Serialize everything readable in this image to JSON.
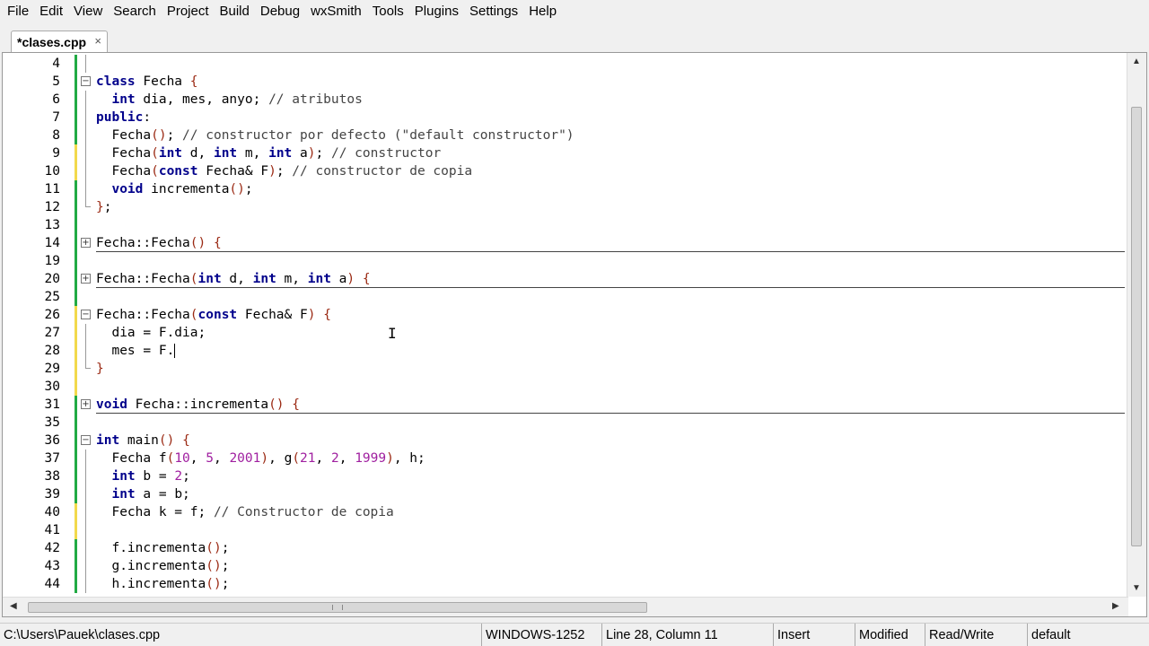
{
  "menu": [
    "File",
    "Edit",
    "View",
    "Search",
    "Project",
    "Build",
    "Debug",
    "wxSmith",
    "Tools",
    "Plugins",
    "Settings",
    "Help"
  ],
  "tab": {
    "label": "*clases.cpp",
    "close": "×"
  },
  "code": [
    {
      "n": "4",
      "fold": "line",
      "mark": "green",
      "html": ""
    },
    {
      "n": "5",
      "fold": "minus",
      "mark": "green",
      "html": "<span class='kw'>class</span> Fecha <span class='br'>{</span>"
    },
    {
      "n": "6",
      "fold": "line",
      "mark": "green",
      "html": "  <span class='kw'>int</span> dia, mes, anyo; <span class='cm'>// atributos</span>"
    },
    {
      "n": "7",
      "fold": "line",
      "mark": "green",
      "html": "<span class='kw'>public</span>:"
    },
    {
      "n": "8",
      "fold": "line",
      "mark": "green",
      "html": "  Fecha<span class='br'>()</span>; <span class='cm'>// constructor por defecto (\"default constructor\")</span>"
    },
    {
      "n": "9",
      "fold": "line",
      "mark": "yellow",
      "html": "  Fecha<span class='br'>(</span><span class='kw'>int</span> d, <span class='kw'>int</span> m, <span class='kw'>int</span> a<span class='br'>)</span>; <span class='cm'>// constructor</span>"
    },
    {
      "n": "10",
      "fold": "line",
      "mark": "yellow",
      "html": "  Fecha<span class='br'>(</span><span class='kw'>const</span> Fecha&amp; F<span class='br'>)</span>; <span class='cm'>// constructor de copia</span>"
    },
    {
      "n": "11",
      "fold": "line",
      "mark": "green",
      "html": "  <span class='kw'>void</span> incrementa<span class='br'>()</span>;"
    },
    {
      "n": "12",
      "fold": "end",
      "mark": "green",
      "html": "<span class='br'>}</span>;"
    },
    {
      "n": "13",
      "fold": "",
      "mark": "green",
      "html": ""
    },
    {
      "n": "14",
      "fold": "plus",
      "mark": "green",
      "rule": true,
      "html": "Fecha::Fecha<span class='br'>()</span> <span class='br'>{</span>"
    },
    {
      "n": "19",
      "fold": "",
      "mark": "green",
      "html": ""
    },
    {
      "n": "20",
      "fold": "plus",
      "mark": "green",
      "rule": true,
      "html": "Fecha::Fecha<span class='br'>(</span><span class='kw'>int</span> d, <span class='kw'>int</span> m, <span class='kw'>int</span> a<span class='br'>)</span> <span class='br'>{</span>"
    },
    {
      "n": "25",
      "fold": "",
      "mark": "green",
      "html": ""
    },
    {
      "n": "26",
      "fold": "minus",
      "mark": "yellow",
      "html": "Fecha::Fecha<span class='br'>(</span><span class='kw'>const</span> Fecha&amp; F<span class='br'>)</span> <span class='br'>{</span>"
    },
    {
      "n": "27",
      "fold": "line",
      "mark": "yellow",
      "html": "  dia = F.dia;"
    },
    {
      "n": "28",
      "fold": "line",
      "mark": "yellow",
      "html": "  mes = F.<span class='cursor'></span>"
    },
    {
      "n": "29",
      "fold": "end",
      "mark": "yellow",
      "html": "<span class='br'>}</span>"
    },
    {
      "n": "30",
      "fold": "",
      "mark": "yellow",
      "html": ""
    },
    {
      "n": "31",
      "fold": "plus",
      "mark": "green",
      "rule": true,
      "html": "<span class='kw'>void</span> Fecha::incrementa<span class='br'>()</span> <span class='br'>{</span>"
    },
    {
      "n": "35",
      "fold": "",
      "mark": "green",
      "html": ""
    },
    {
      "n": "36",
      "fold": "minus",
      "mark": "green",
      "html": "<span class='kw'>int</span> main<span class='br'>()</span> <span class='br'>{</span>"
    },
    {
      "n": "37",
      "fold": "line",
      "mark": "green",
      "html": "  Fecha f<span class='br'>(</span><span class='num'>10</span>, <span class='num'>5</span>, <span class='num'>2001</span><span class='br'>)</span>, g<span class='br'>(</span><span class='num'>21</span>, <span class='num'>2</span>, <span class='num'>1999</span><span class='br'>)</span>, h;"
    },
    {
      "n": "38",
      "fold": "line",
      "mark": "green",
      "html": "  <span class='kw'>int</span> b = <span class='num'>2</span>;"
    },
    {
      "n": "39",
      "fold": "line",
      "mark": "green",
      "html": "  <span class='kw'>int</span> a = b;"
    },
    {
      "n": "40",
      "fold": "line",
      "mark": "yellow",
      "html": "  Fecha k = f; <span class='cm'>// Constructor de copia</span>"
    },
    {
      "n": "41",
      "fold": "line",
      "mark": "yellow",
      "html": ""
    },
    {
      "n": "42",
      "fold": "line",
      "mark": "green",
      "html": "  f.incrementa<span class='br'>()</span>;"
    },
    {
      "n": "43",
      "fold": "line",
      "mark": "green",
      "html": "  g.incrementa<span class='br'>()</span>;"
    },
    {
      "n": "44",
      "fold": "line",
      "mark": "green",
      "html": "  h.incrementa<span class='br'>()</span>;"
    }
  ],
  "status": {
    "path": "C:\\Users\\Pauek\\clases.cpp",
    "encoding": "WINDOWS-1252",
    "position": "Line 28, Column 11",
    "mode": "Insert",
    "modified": "Modified",
    "access": "Read/Write",
    "lang": "default"
  },
  "icons": {
    "scroll_up": "▲",
    "scroll_down": "▼",
    "scroll_left": "◀",
    "scroll_right": "▶",
    "ibeam": "I"
  }
}
